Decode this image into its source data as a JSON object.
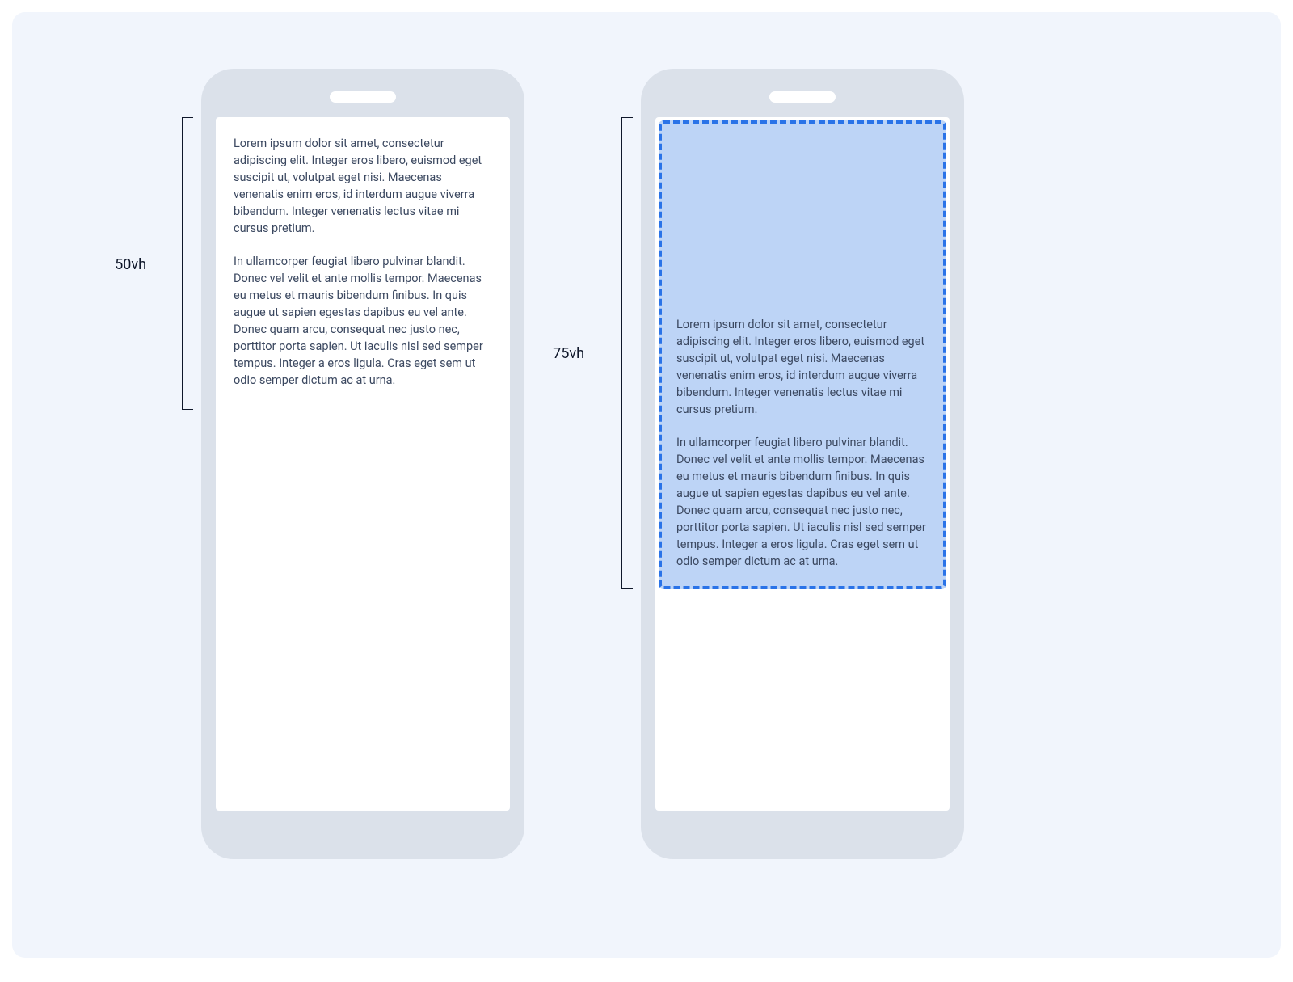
{
  "labels": {
    "left": "50vh",
    "right": "75vh"
  },
  "paragraphs": {
    "p1": "Lorem ipsum dolor sit amet, consectetur adipiscing elit. Integer eros libero, euismod eget suscipit ut, volutpat eget nisi. Maecenas venenatis enim eros, id interdum augue viverra bibendum. Integer venenatis lectus vitae mi cursus pretium.",
    "p2": "In ullamcorper feugiat libero pulvinar blandit. Donec vel velit et ante mollis tempor. Maecenas eu metus et mauris bibendum finibus. In quis augue ut sapien egestas dapibus eu vel ante. Donec quam arcu, consequat nec justo nec, porttitor porta sapien. Ut iaculis nisl sed semper tempus. Integer a eros ligula. Cras eget sem ut odio semper dictum ac at urna."
  },
  "colors": {
    "canvas_bg": "#f1f5fc",
    "phone_body": "#dbe1ea",
    "screen_bg": "#ffffff",
    "text": "#3b4860",
    "bracket": "#0f172a",
    "overlay_fill": "#bdd4f6",
    "overlay_border": "#2a73e8"
  },
  "diagram": {
    "description": "Two phone mockups comparing viewport-height-based intersection thresholds: left shows content visible at 50vh, right shows an intersection overlay at 75vh.",
    "left_vh": 50,
    "right_vh": 75
  }
}
